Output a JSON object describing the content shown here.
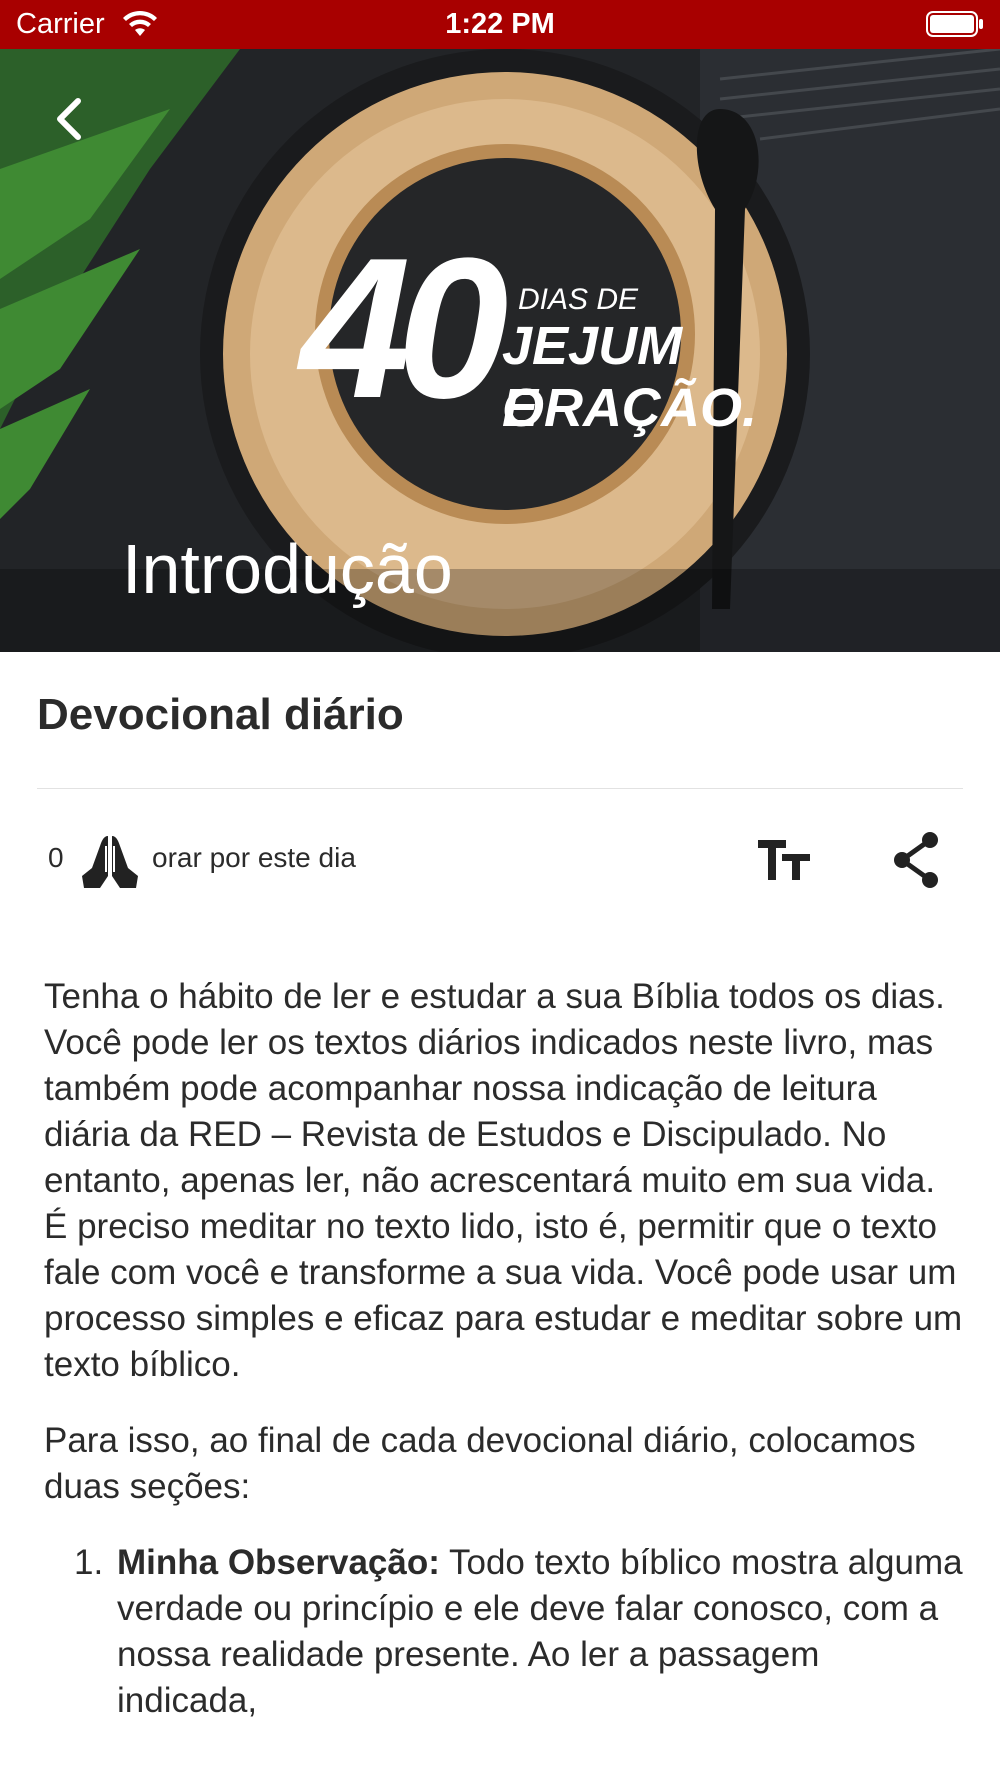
{
  "status_bar": {
    "carrier": "Carrier",
    "time": "1:22 PM"
  },
  "hero": {
    "logo_number": "40",
    "logo_line1": "DIAS DE",
    "logo_line2": "JEJUM E",
    "logo_line3": "ORAÇÃO.",
    "title": "Introdução"
  },
  "section": {
    "title": "Devocional diário"
  },
  "actions": {
    "pray_count": "0",
    "pray_label": "orar por este dia"
  },
  "content": {
    "paragraph1": "Tenha o hábito de ler e estudar a sua Bíblia todos os dias. Você pode ler os textos diários indicados neste livro, mas também pode acompanhar nossa indicação de leitura diária da RED – Revista de Estudos e Discipulado. No entanto, apenas ler, não acrescentará muito em sua vida. É preciso meditar no texto lido, isto é, permitir que o texto fale com você e transforme a sua vida. Você pode usar um processo simples e eficaz para estudar e meditar sobre um texto bíblico.",
    "paragraph2": "Para isso, ao final de cada devocional diário, colocamos duas seções:",
    "list": [
      {
        "number": "1.",
        "strong": "Minha Observação:",
        "text": " Todo texto bíblico mostra alguma verdade ou princípio e ele deve falar conosco, com a nossa realidade presente. Ao ler a passagem indicada,"
      }
    ]
  },
  "colors": {
    "status_bar": "#a80000",
    "text": "#2b2b2b",
    "divider": "#e2e2e2"
  },
  "icons": [
    "wifi-icon",
    "battery-icon",
    "back-chevron-icon",
    "praying-hands-icon",
    "font-size-icon",
    "share-icon"
  ]
}
